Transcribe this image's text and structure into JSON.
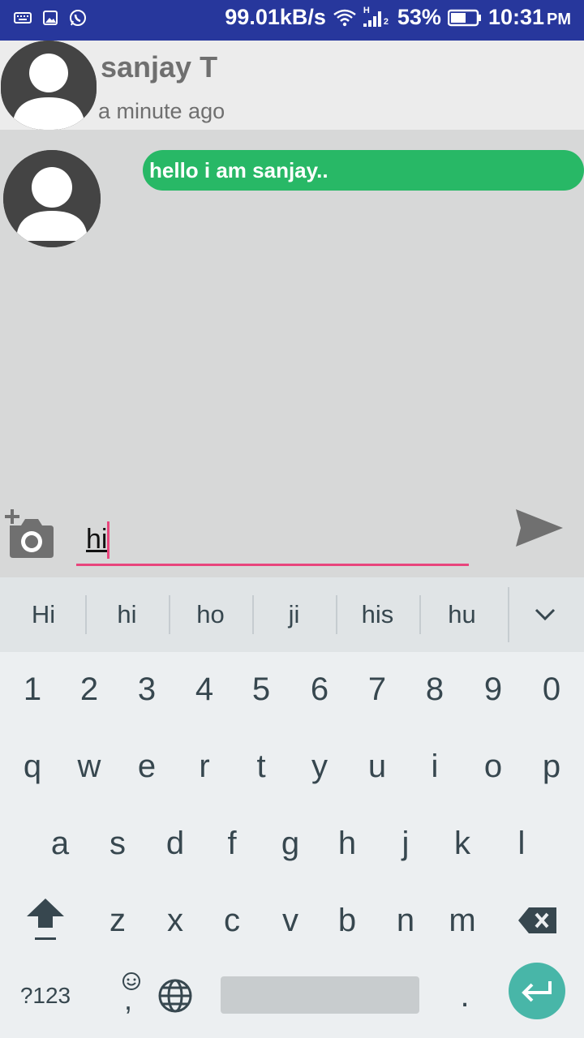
{
  "status_bar": {
    "icons_left": [
      "keyboard-icon",
      "image-icon",
      "whatsapp-icon"
    ],
    "network_speed": "99.01kB/s",
    "signal_label": "H",
    "signal_sub": "2",
    "battery": "53%",
    "time": "10:31",
    "ampm": "PM"
  },
  "header": {
    "name": "sanjay T",
    "status": "a minute ago"
  },
  "chat": {
    "messages": [
      {
        "text": "hello i am sanjay.."
      }
    ]
  },
  "composer": {
    "value": "hi"
  },
  "keyboard": {
    "suggestions": [
      "Hi",
      "hi",
      "ho",
      "ji",
      "his",
      "hu"
    ],
    "number_row": [
      "1",
      "2",
      "3",
      "4",
      "5",
      "6",
      "7",
      "8",
      "9",
      "0"
    ],
    "row1": [
      "q",
      "w",
      "e",
      "r",
      "t",
      "y",
      "u",
      "i",
      "o",
      "p"
    ],
    "row2": [
      "a",
      "s",
      "d",
      "f",
      "g",
      "h",
      "j",
      "k",
      "l"
    ],
    "row3": [
      "z",
      "x",
      "c",
      "v",
      "b",
      "n",
      "m"
    ],
    "symbols_key": "?123",
    "comma_key": ",",
    "period_key": ".",
    "accent_color": "#48b6a8"
  },
  "colors": {
    "status_bar": "#27379c",
    "bubble": "#28b866",
    "input_underline": "#e8457c"
  }
}
